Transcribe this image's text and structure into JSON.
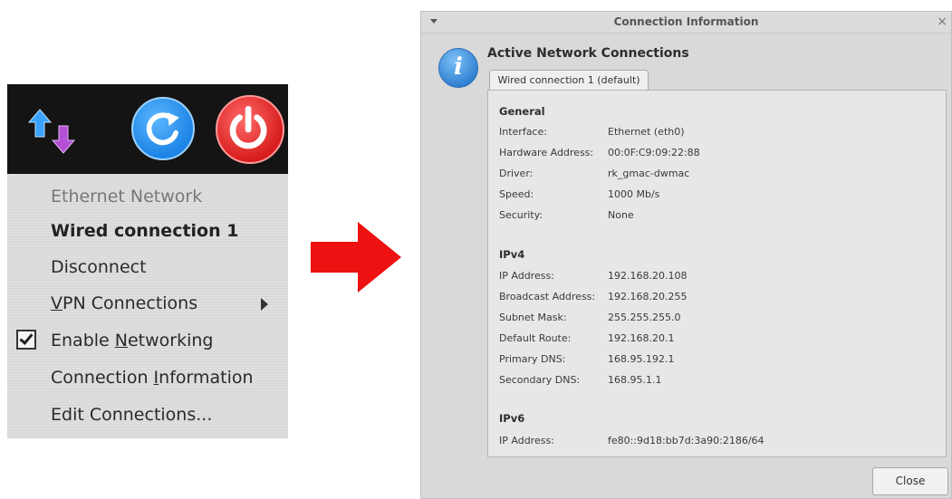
{
  "tray_menu": {
    "items": {
      "header": "Ethernet Network",
      "wired": "Wired connection 1",
      "disconnect": "Disconnect",
      "vpn": {
        "pre": "",
        "u": "V",
        "post": "PN Connections"
      },
      "enable": {
        "pre": "Enable ",
        "u": "N",
        "post": "etworking"
      },
      "info": {
        "pre": "Connection ",
        "u": "I",
        "post": "nformation"
      },
      "edit": "Edit Connections..."
    },
    "enable_networking_checked": true,
    "icons": [
      "network-arrows-icon",
      "refresh-icon",
      "power-icon"
    ]
  },
  "dialog": {
    "title": "Connection Information",
    "heading": "Active Network Connections",
    "tab": "Wired connection 1 (default)",
    "close_button": "Close",
    "close_glyph": "×",
    "sections": {
      "general": {
        "title": "General",
        "rows": [
          {
            "label": "Interface:",
            "value": "Ethernet (eth0)"
          },
          {
            "label": "Hardware Address:",
            "value": "00:0F:C9:09:22:88"
          },
          {
            "label": "Driver:",
            "value": "rk_gmac-dwmac"
          },
          {
            "label": "Speed:",
            "value": "1000 Mb/s"
          },
          {
            "label": "Security:",
            "value": "None"
          }
        ]
      },
      "ipv4": {
        "title": "IPv4",
        "rows": [
          {
            "label": "IP Address:",
            "value": "192.168.20.108"
          },
          {
            "label": "Broadcast Address:",
            "value": "192.168.20.255"
          },
          {
            "label": "Subnet Mask:",
            "value": "255.255.255.0"
          },
          {
            "label": "Default Route:",
            "value": "192.168.20.1"
          },
          {
            "label": "Primary DNS:",
            "value": "168.95.192.1"
          },
          {
            "label": "Secondary DNS:",
            "value": "168.95.1.1"
          }
        ]
      },
      "ipv6": {
        "title": "IPv6",
        "rows": [
          {
            "label": "IP Address:",
            "value": "fe80::9d18:bb7d:3a90:2186/64"
          }
        ]
      }
    }
  },
  "colors": {
    "highlight_box": "#dd1111",
    "arrow": "#ee1111",
    "refresh": "#1b84e6",
    "power": "#d81d1d"
  }
}
